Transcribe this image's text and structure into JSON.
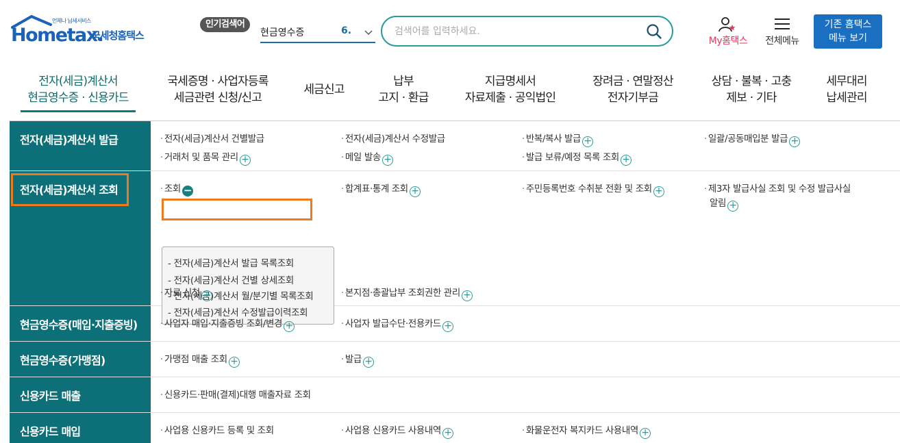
{
  "header": {
    "logo_small": "언제나 납세서비스",
    "logo_main": "Hometax.",
    "logo_sub": "국세청홈택스",
    "popular_badge": "인기검색어",
    "popular_term": "현금영수증",
    "popular_rank": "6.",
    "search_placeholder": "검색어를 입력하세요.",
    "my_hometax": "My홈택스",
    "all_menu": "전체메뉴",
    "old_menu_line1": "기존 홈택스",
    "old_menu_line2": "메뉴 보기"
  },
  "nav": {
    "items": [
      {
        "line1": "전자(세금)계산서",
        "line2": "현금영수증 · 신용카드"
      },
      {
        "line1": "국세증명 · 사업자등록",
        "line2": "세금관련 신청/신고"
      },
      {
        "line1": "세금신고",
        "line2": ""
      },
      {
        "line1": "납부",
        "line2": "고지 · 환급"
      },
      {
        "line1": "지급명세서",
        "line2": "자료제출 · 공익법인"
      },
      {
        "line1": "장려금 · 연말정산",
        "line2": "전자기부금"
      },
      {
        "line1": "상담 · 불복 · 고충",
        "line2": "제보 · 기타"
      },
      {
        "line1": "세무대리",
        "line2": "납세관리"
      }
    ]
  },
  "menu": {
    "rows": [
      {
        "title": "전자(세금)계산서 발급",
        "items": [
          "전자(세금)계산서 건별발급",
          "전자(세금)계산서 수정발급",
          "반복/복사 발급",
          "일괄/공동매입분 발급",
          "거래처 및 품목 관리",
          "메일 발송",
          "발급 보류/예정 목록 조회"
        ]
      },
      {
        "title": "전자(세금)계산서 조회",
        "items": [
          "조회",
          "합계표·통계 조회",
          "주민등록번호 수취분 전환 및 조회",
          "제3자 발급사실 조회 및 수정 발급사실",
          "알림",
          "자료 신청",
          "본지점·총괄납부 조회권한 관리"
        ],
        "submenu": [
          "전자(세금)계산서 발급 목록조회",
          "전자(세금)계산서 건별 상세조회",
          "전자(세금)계산서 월/분기별 목록조회",
          "전자(세금)계산서 수정발급이력조회"
        ]
      },
      {
        "title": "현금영수증(매입·지출증빙)",
        "items": [
          "사업자 매입·지출증빙 조회/변경",
          "사업자 발급수단·전용카드"
        ]
      },
      {
        "title": "현금영수증(가맹점)",
        "items": [
          "가맹점 매출 조회",
          "발급"
        ]
      },
      {
        "title": "신용카드 매출",
        "items": [
          "신용카드·판매(결제)대행 매출자료 조회"
        ]
      },
      {
        "title": "신용카드 매입",
        "items": [
          "사업용 신용카드 등록 및 조회",
          "사업용 신용카드 사용내역",
          "화물운전자 복지카드 사용내역"
        ]
      }
    ]
  },
  "colors": {
    "accent": "#0d6f78",
    "highlight": "#f07a1e",
    "brand": "#1b63b8"
  }
}
